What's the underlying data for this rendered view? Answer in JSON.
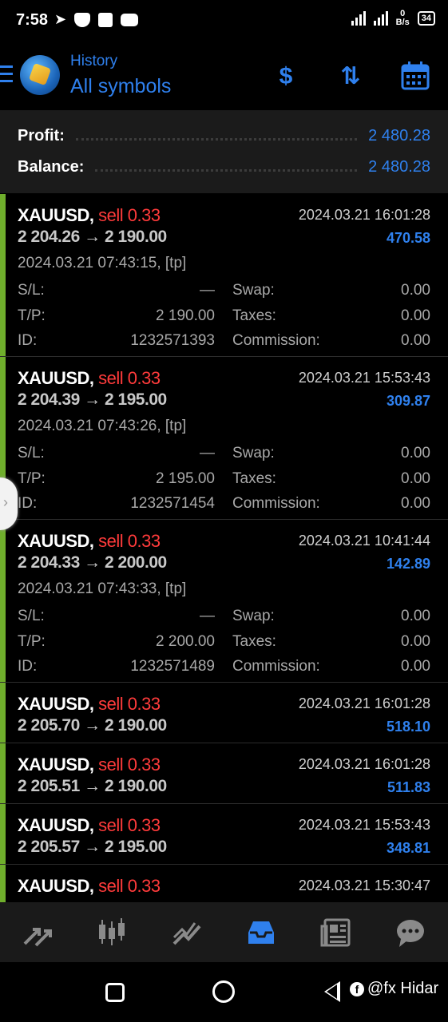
{
  "status_bar": {
    "time": "7:58",
    "net_speed_value": "0",
    "net_speed_unit": "B/s",
    "battery": "34"
  },
  "header": {
    "subtitle": "History",
    "title": "All symbols"
  },
  "summary": [
    {
      "label": "Profit:",
      "value": "2 480.28"
    },
    {
      "label": "Balance:",
      "value": "2 480.28"
    }
  ],
  "field_labels": {
    "sl": "S/L:",
    "tp": "T/P:",
    "id": "ID:",
    "swap": "Swap:",
    "taxes": "Taxes:",
    "commission": "Commission:"
  },
  "deals": [
    {
      "symbol": "XAUUSD,",
      "side": "sell 0.33",
      "open_price": "2 204.26",
      "close_price": "2 190.00",
      "close_time": "2024.03.21 16:01:28",
      "profit": "470.58",
      "open_time": "2024.03.21 07:43:15, [tp]",
      "sl": "—",
      "tp": "2 190.00",
      "id": "1232571393",
      "swap": "0.00",
      "taxes": "0.00",
      "commission": "0.00"
    },
    {
      "symbol": "XAUUSD,",
      "side": "sell 0.33",
      "open_price": "2 204.39",
      "close_price": "2 195.00",
      "close_time": "2024.03.21 15:53:43",
      "profit": "309.87",
      "open_time": "2024.03.21 07:43:26, [tp]",
      "sl": "—",
      "tp": "2 195.00",
      "id": "1232571454",
      "swap": "0.00",
      "taxes": "0.00",
      "commission": "0.00"
    },
    {
      "symbol": "XAUUSD,",
      "side": "sell 0.33",
      "open_price": "2 204.33",
      "close_price": "2 200.00",
      "close_time": "2024.03.21 10:41:44",
      "profit": "142.89",
      "open_time": "2024.03.21 07:43:33, [tp]",
      "sl": "—",
      "tp": "2 200.00",
      "id": "1232571489",
      "swap": "0.00",
      "taxes": "0.00",
      "commission": "0.00"
    },
    {
      "symbol": "XAUUSD,",
      "side": "sell 0.33",
      "open_price": "2 205.70",
      "close_price": "2 190.00",
      "close_time": "2024.03.21 16:01:28",
      "profit": "518.10"
    },
    {
      "symbol": "XAUUSD,",
      "side": "sell 0.33",
      "open_price": "2 205.51",
      "close_price": "2 190.00",
      "close_time": "2024.03.21 16:01:28",
      "profit": "511.83"
    },
    {
      "symbol": "XAUUSD,",
      "side": "sell 0.33",
      "open_price": "2 205.57",
      "close_price": "2 195.00",
      "close_time": "2024.03.21 15:53:43",
      "profit": "348.81"
    },
    {
      "symbol": "XAUUSD,",
      "side": "sell 0.33",
      "open_price": "",
      "close_price": "",
      "close_time": "2024.03.21 15:30:47",
      "profit": ""
    }
  ],
  "price_arrow": "→",
  "watermark": "@fx Hidar",
  "colors": {
    "accent": "#2f80ed",
    "sell": "#ff3b3b",
    "deal_bar": "#6fae2c",
    "background": "#000000"
  }
}
